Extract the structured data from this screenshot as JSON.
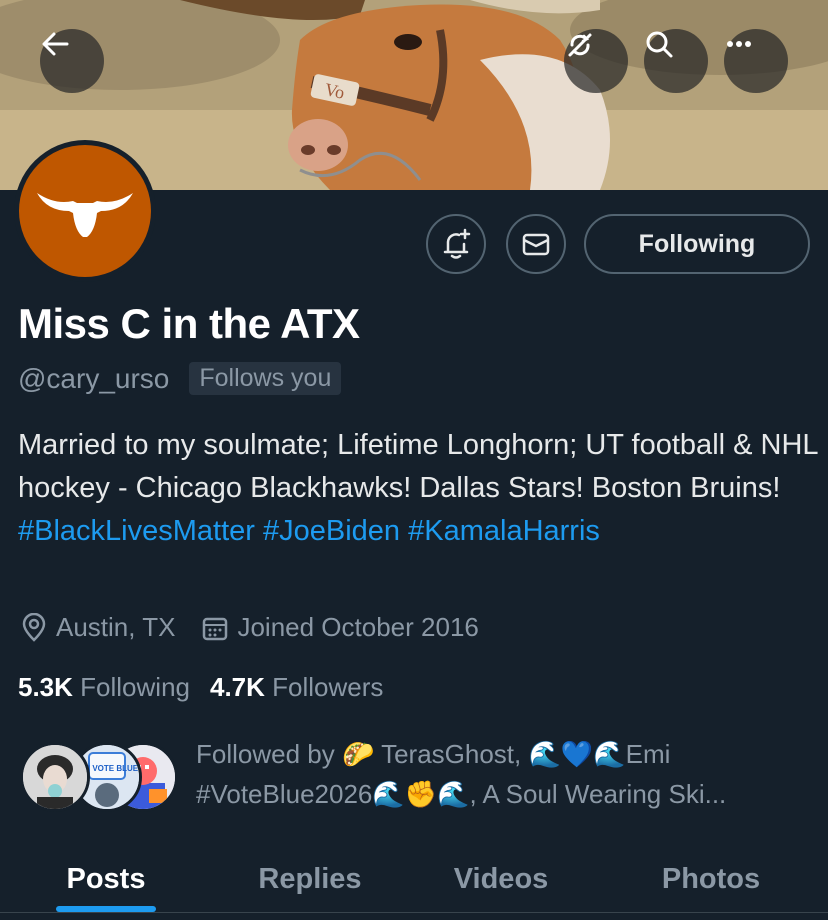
{
  "profile": {
    "display_name": "Miss C in the ATX",
    "handle": "@cary_urso",
    "follows_you": "Follows you",
    "bio_text": "Married to my soulmate; Lifetime Longhorn; UT football & NHL hockey - Chicago Blackhawks! Dallas Stars! Boston Bruins! ",
    "bio_hashtags": [
      "#BlackLivesMatter",
      "#JoeBiden",
      "#KamalaHarris"
    ],
    "location": "Austin, TX",
    "joined": "Joined October 2016"
  },
  "banner": {
    "collar_text": "Vo"
  },
  "actions": {
    "following_label": "Following"
  },
  "stats": {
    "following_count": "5.3K",
    "following_label": "Following",
    "followers_count": "4.7K",
    "followers_label": "Followers"
  },
  "followed_by": {
    "text": "Followed by 🌮 TerasGhost, 🌊💙🌊Emi #VoteBlue2026🌊✊🌊, A Soul Wearing Ski...",
    "avatar_badge": "EMI VOTE BLUE"
  },
  "tabs": [
    {
      "label": "Posts",
      "active": true
    },
    {
      "label": "Replies",
      "active": false
    },
    {
      "label": "Videos",
      "active": false
    },
    {
      "label": "Photos",
      "active": false
    }
  ],
  "colors": {
    "background": "#15202b",
    "accent": "#1d9bf0",
    "longhorn_orange": "#bf5700",
    "secondary_text": "#8b98a5"
  },
  "icons": [
    "back-arrow-icon",
    "no-sync-icon",
    "search-icon",
    "more-icon",
    "bell-plus-icon",
    "mail-icon",
    "location-icon",
    "calendar-icon"
  ]
}
